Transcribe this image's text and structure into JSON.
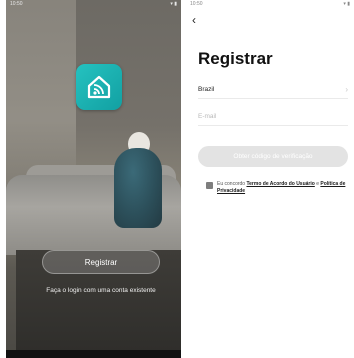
{
  "left_screen": {
    "status_time": "10:50",
    "register_label": "Registrar",
    "login_text": "Faça o login com uma conta existente"
  },
  "right_screen": {
    "status_time": "10:50",
    "back_icon": "back-arrow-icon",
    "title": "Registrar",
    "country": "Brazil",
    "email_placeholder": "E-mail",
    "email_value": "",
    "verify_button_label": "Obter código de verificação",
    "terms": {
      "prefix": "Eu concordo ",
      "terms_link": "Termo de Acordo do Usuário",
      "connector": " e ",
      "privacy_link": "Política de Privacidade"
    }
  },
  "colors": {
    "logo_accent": "#1fb4b4",
    "button_disabled": "#e3e3e3"
  }
}
